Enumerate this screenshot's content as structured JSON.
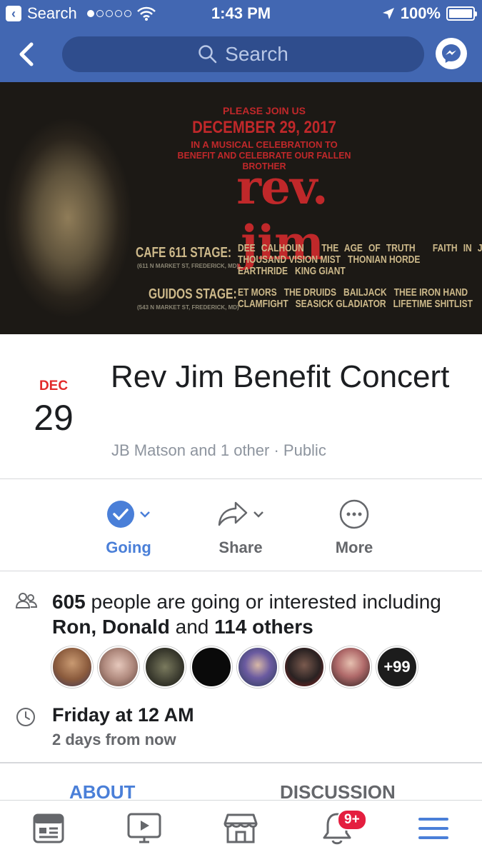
{
  "status_bar": {
    "carrier_back": "Search",
    "time": "1:43 PM",
    "battery": "100%",
    "signal_dots": 5,
    "signal_filled": 1
  },
  "nav": {
    "search_placeholder": "Search"
  },
  "banner": {
    "line1": "PLEASE JOIN US",
    "line2": "DECEMBER 29, 2017",
    "line3": "IN A MUSICAL CELEBRATION TO",
    "line4": "BENEFIT AND CELEBRATE OUR FALLEN BROTHER",
    "headline": "rev. jim",
    "stage1": "CAFE 611 STAGE:",
    "stage1_addr": "(611 N MARKET ST, FREDERICK, MD)",
    "stage1_row1": [
      "DEE CALHOUN",
      "THE AGE OF TRUTH",
      "FAITH IN JANE"
    ],
    "stage1_row2": [
      "THOUSAND VISION MIST",
      "THONIAN HORDE"
    ],
    "stage1_row3": [
      "EARTHRIDE",
      "KING GIANT"
    ],
    "stage2": "GUIDOS STAGE:",
    "stage2_addr": "(543 N MARKET ST, FREDERICK, MD)",
    "stage2_row1": [
      "ET MORS",
      "THE DRUIDS",
      "BAILJACK",
      "THEE IRON HAND"
    ],
    "stage2_row2": [
      "CLAMFIGHT",
      "SEASICK GLADIATOR",
      "LIFETIME SHITLIST"
    ]
  },
  "event": {
    "month": "DEC",
    "day": "29",
    "title": "Rev Jim Benefit Concert",
    "subtitle": "JB Matson and 1 other · Public"
  },
  "actions": [
    {
      "label": "Going",
      "icon": "check-circle-icon"
    },
    {
      "label": "Share",
      "icon": "share-arrow-icon"
    },
    {
      "label": "More",
      "icon": "more-dots-icon"
    }
  ],
  "people": {
    "count": "605",
    "text1": " people are going or interested including ",
    "names": "Ron, Donald",
    "text2": " and ",
    "others": "114 others",
    "avatar_colors": [
      "#8a5a3c",
      "#b08a7e",
      "#3a3a2e",
      "#0a0a0a",
      "#4b6a8a",
      "#2a2222",
      "#6b4a4a"
    ],
    "more_label": "+99"
  },
  "time": {
    "when": "Friday at 12 AM",
    "relative": "2 days from now"
  },
  "tabs": [
    "ABOUT",
    "DISCUSSION"
  ],
  "bottom_bar": {
    "items": [
      "news-feed-icon",
      "watch-icon",
      "marketplace-icon",
      "notifications-icon",
      "menu-icon"
    ],
    "notification_badge": "9+"
  },
  "colors": {
    "brand": "#4267b2",
    "accent": "#4a7fd8",
    "date_red": "#e22a2a",
    "badge_red": "#e41e3f"
  }
}
